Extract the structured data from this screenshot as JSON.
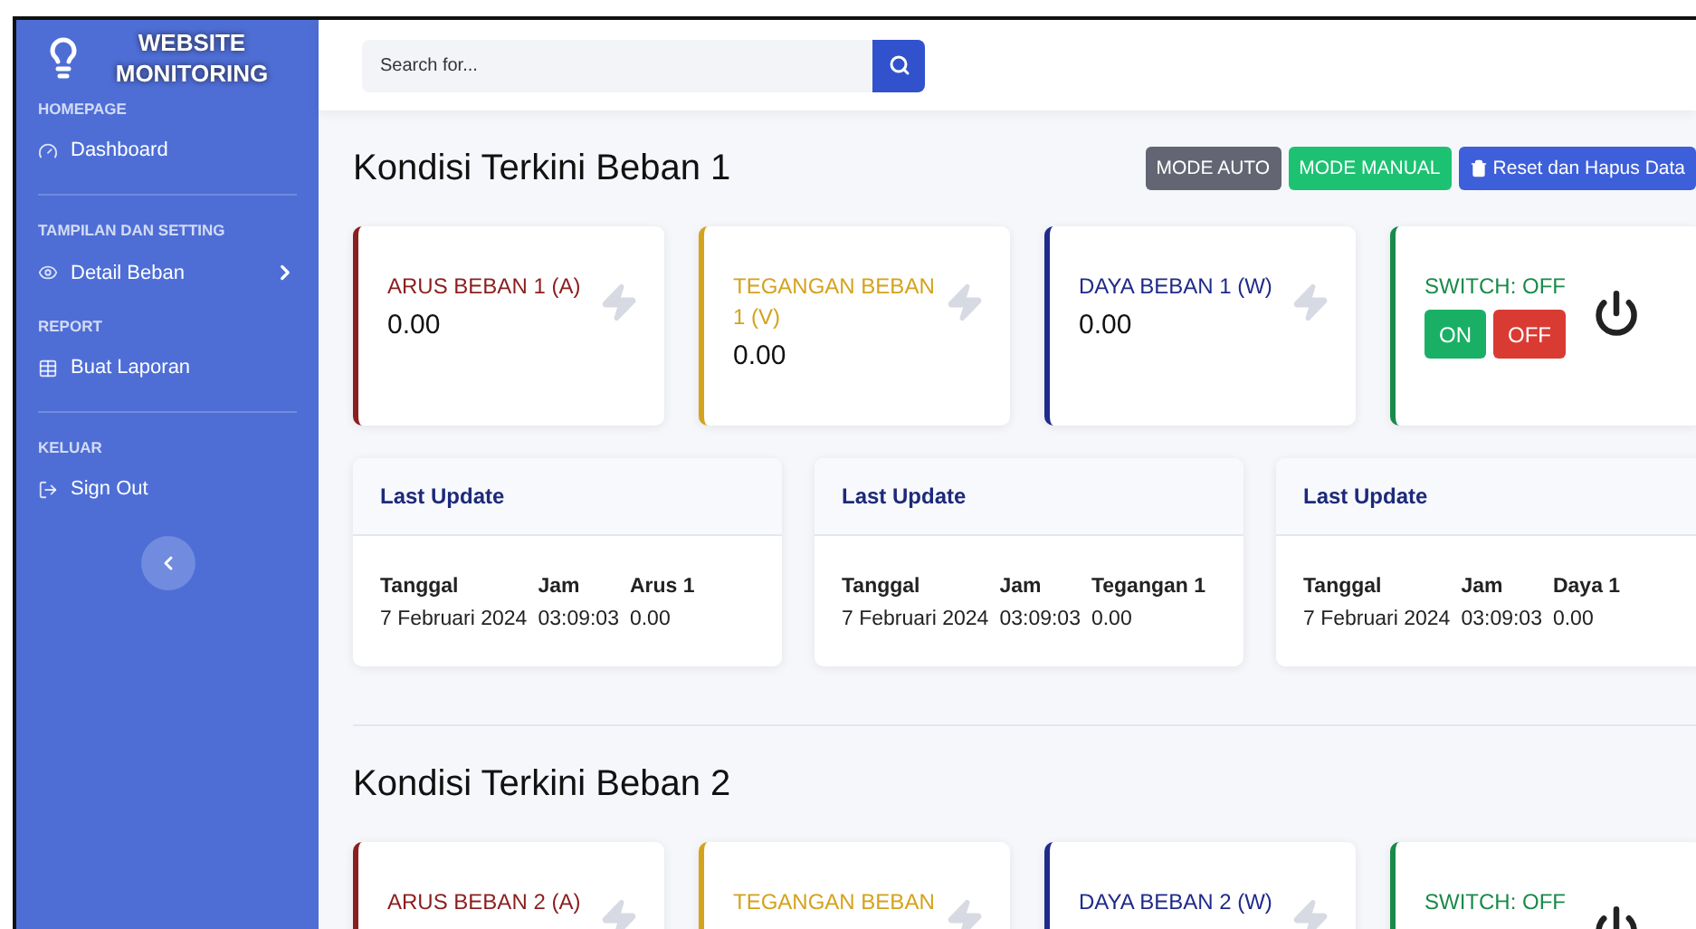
{
  "sidebar": {
    "brand": "WEBSITE MONITORING",
    "sections": [
      {
        "heading": "HOMEPAGE",
        "divider": true,
        "items": [
          {
            "label": "Dashboard",
            "has_submenu": false
          }
        ]
      },
      {
        "heading": "TAMPILAN DAN SETTING",
        "divider": false,
        "items": [
          {
            "label": "Detail Beban",
            "has_submenu": true
          }
        ]
      },
      {
        "heading": "REPORT",
        "divider": true,
        "items": [
          {
            "label": "Buat Laporan",
            "has_submenu": false
          }
        ]
      },
      {
        "heading": "KELUAR",
        "divider": false,
        "items": [
          {
            "label": "Sign Out",
            "has_submenu": false
          }
        ]
      }
    ]
  },
  "search": {
    "placeholder": "Search for..."
  },
  "sections": [
    {
      "title": "Kondisi Terkini Beban 1",
      "buttons": [
        {
          "label": "MODE AUTO",
          "kind": "secondary"
        },
        {
          "label": "MODE MANUAL",
          "kind": "success"
        },
        {
          "label": "Reset dan Hapus Data",
          "kind": "primary"
        }
      ],
      "cards": [
        {
          "kind": "metric",
          "label": "ARUS BEBAN 1 (A)",
          "value": "0.00",
          "color": "#8b1e1e"
        },
        {
          "kind": "metric",
          "label": "TEGANGAN BEBAN 1 (V)",
          "value": "0.00",
          "color": "#d4a21c"
        },
        {
          "kind": "metric",
          "label": "DAYA BEBAN 1 (W)",
          "value": "0.00",
          "color": "#1f2a8a"
        },
        {
          "kind": "switch",
          "label": "SWITCH: OFF",
          "buttons": [
            "ON",
            "OFF"
          ],
          "color": "#1a8a4a"
        }
      ],
      "updates": [
        {
          "title": "Last Update",
          "columns": [
            "Tanggal",
            "Jam",
            "Arus 1"
          ],
          "values": [
            "7 Februari 2024",
            "03:09:03",
            "0.00"
          ]
        },
        {
          "title": "Last Update",
          "columns": [
            "Tanggal",
            "Jam",
            "Tegangan 1"
          ],
          "values": [
            "7 Februari 2024",
            "03:09:03",
            "0.00"
          ]
        },
        {
          "title": "Last Update",
          "columns": [
            "Tanggal",
            "Jam",
            "Daya 1"
          ],
          "values": [
            "7 Februari 2024",
            "03:09:03",
            "0.00"
          ]
        }
      ]
    },
    {
      "title": "Kondisi Terkini Beban 2",
      "cards": [
        {
          "kind": "metric",
          "label": "ARUS BEBAN 2 (A)",
          "color": "#8b1e1e"
        },
        {
          "kind": "metric",
          "label": "TEGANGAN BEBAN",
          "color": "#d4a21c"
        },
        {
          "kind": "metric",
          "label": "DAYA BEBAN 2 (W)",
          "color": "#1f2a8a"
        },
        {
          "kind": "switch",
          "label": "SWITCH: OFF",
          "color": "#1a8a4a"
        }
      ]
    }
  ]
}
